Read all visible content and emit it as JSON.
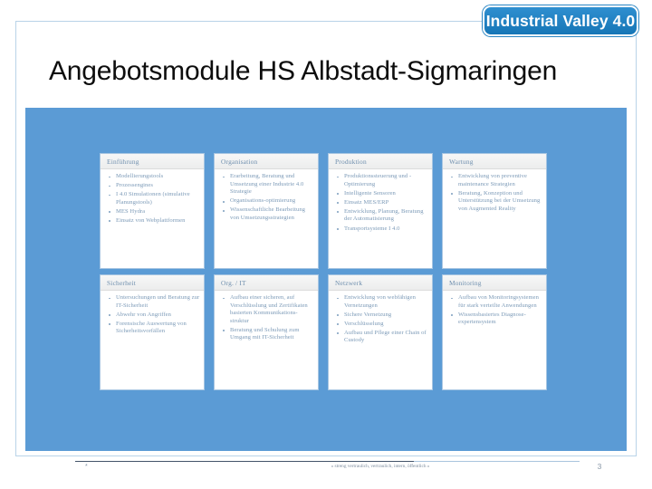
{
  "logo": {
    "text": "Industrial Valley 4.0",
    "color": "#1f7fc0"
  },
  "title": "Angebotsmodule HS Albstadt-Sigmaringen",
  "panel": {
    "color": "#5b9bd5"
  },
  "cards": [
    {
      "header": "Einführung",
      "bullets": [
        "Modellierungstools",
        "Prozessengines",
        "I 4.0 Simulationen (simulative Planungstools)",
        "MES Hydra",
        "Einsatz von Webplattformen"
      ]
    },
    {
      "header": "Organisation",
      "bullets": [
        "Erarbeitung, Beratung und Umsetzung einer Industrie 4.0 Strategie",
        "Organisations-optimierung",
        "Wissenschaftliche Bearbeitung von Umsetzungsstrategien"
      ]
    },
    {
      "header": "Produktion",
      "bullets": [
        "Produktionssteuerung und -Optimierung",
        "Intelligente Sensoren",
        "Einsatz MES/ERP",
        "Entwicklung, Planung, Beratung der Automatisierung",
        "Transportsysteme I 4.0"
      ]
    },
    {
      "header": "Wartung",
      "bullets": [
        "Entwicklung von preventive maintenance Strategien",
        "Beratung, Konzeption und Unterstützung bei der Umsetzung von Augmented Reality"
      ]
    },
    {
      "header": "Sicherheit",
      "bullets": [
        "Untersuchungen und Beratung zur IT-Sicherheit",
        "Abwehr von Angriffen",
        "Forensische Auswertung von Sicherheitsvorfällen"
      ]
    },
    {
      "header": "Org. / IT",
      "bullets": [
        "Aufbau einer sicheren, auf Verschlüsslung und Zertifikaten basierten Kommunikations-struktur",
        "Beratung und Schulung zum Umgang mit IT-Sicherheit"
      ]
    },
    {
      "header": "Netzwerk",
      "bullets": [
        "Entwicklung von webfähigen Vernetzungen",
        "Sichere Vernetzung",
        "Verschlüsselung",
        "Aufbau und Pflege einer Chain of Custody"
      ]
    },
    {
      "header": "Monitoring",
      "bullets": [
        "Aufbau von Monitoringsystemen für stark verteilte Anwendungen",
        "Wissensbasiertes Diagnose-expertensystem"
      ]
    }
  ],
  "footer": {
    "star": "*",
    "classification": "« streng vertraulich, vertraulich, intern, öffentlich »",
    "page": "3"
  }
}
